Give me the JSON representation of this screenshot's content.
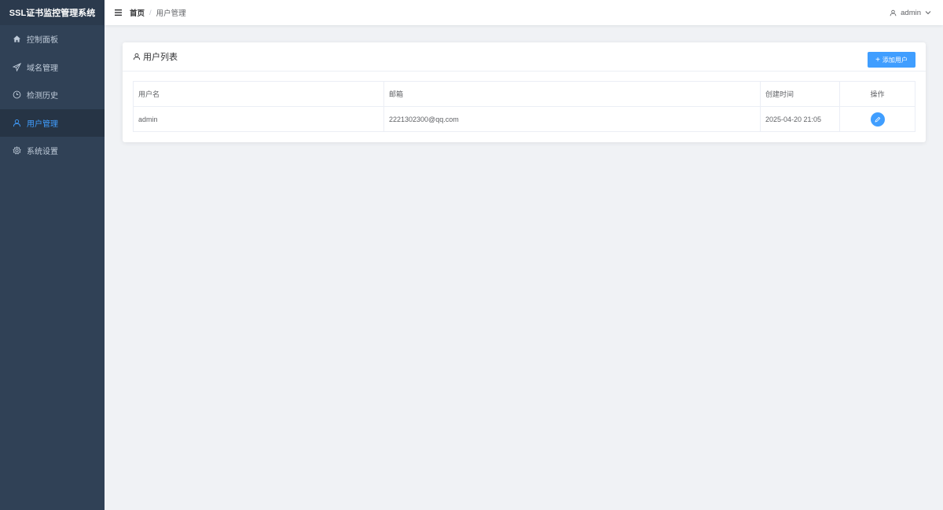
{
  "app": {
    "title": "SSL证书监控管理系统"
  },
  "sidebar": {
    "items": [
      {
        "label": "控制面板",
        "icon": "home-icon"
      },
      {
        "label": "域名管理",
        "icon": "send-icon"
      },
      {
        "label": "检测历史",
        "icon": "clock-icon"
      },
      {
        "label": "用户管理",
        "icon": "user-icon",
        "active": true
      },
      {
        "label": "系统设置",
        "icon": "gear-icon"
      }
    ]
  },
  "header": {
    "breadcrumb": {
      "home": "首页",
      "separator": "/",
      "current": "用户管理"
    },
    "user": "admin"
  },
  "card": {
    "title": "用户列表",
    "add_button": "添加用户"
  },
  "table": {
    "columns": [
      "用户名",
      "邮箱",
      "创建时间",
      "操作"
    ],
    "rows": [
      {
        "username": "admin",
        "email": "2221302300@qq.com",
        "created": "2025-04-20 21:05"
      }
    ]
  },
  "colors": {
    "sidebar_bg": "#304156",
    "accent": "#409eff",
    "page_bg": "#f0f2f5"
  }
}
